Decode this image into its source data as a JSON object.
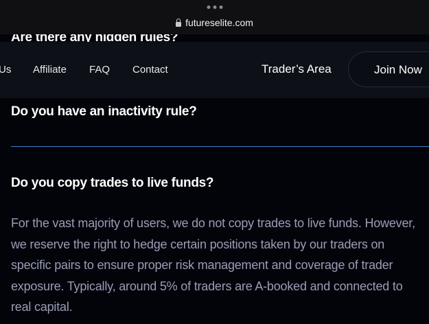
{
  "browser": {
    "url": "futureselite.com",
    "lock_icon": "lock-icon"
  },
  "faq": {
    "hidden_question": "Are there any hidden rules?",
    "question_inactivity": "Do you have an inactivity rule?",
    "question_copy_trades": "Do you copy trades to live funds?",
    "answer_copy_trades": "For the vast majority of users, we do not copy trades to live funds. However, we reserve the right to hedge certain positions taken by our traders on specific pairs to ensure proper risk management and coverage of trader exposure. Typically, around 5% of traders are A-booked and connected to real capital."
  },
  "nav": {
    "about_us_partial": "Us",
    "affiliate": "Affiliate",
    "faq": "FAQ",
    "contact": "Contact",
    "traders_area": "Trader’s Area",
    "join_now": "Join Now"
  },
  "colors": {
    "background": "#02040a",
    "header_bg": "#0d1117",
    "divider_accent": "#3f7fc8",
    "answer_text": "#9a9db6"
  }
}
